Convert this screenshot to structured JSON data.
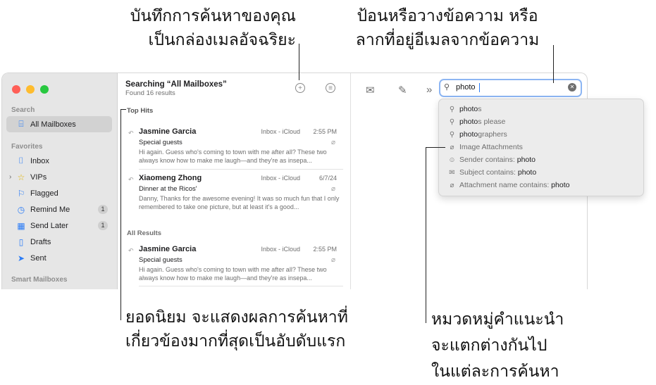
{
  "callouts": {
    "top_left": [
      "บันทึกการค้นหาของคุณ",
      "เป็นกล่องเมลอัจฉริยะ"
    ],
    "top_right": [
      "ป้อนหรือวางข้อความ หรือ",
      "ลากที่อยู่อีเมลจากข้อความ"
    ],
    "bottom_left": [
      "ยอดนิยม จะแสดงผลการค้นหาที่",
      "เกี่ยวข้องมากที่สุดเป็นอับดับแรก"
    ],
    "bottom_right": [
      "หมวดหมู่คำแนะนำ",
      "จะแตกต่างกันไป",
      "ในแต่ละการค้นหา"
    ]
  },
  "sidebar": {
    "search_section": "Search",
    "search_item": "All Mailboxes",
    "favorites_section": "Favorites",
    "items": [
      {
        "label": "Inbox",
        "icon": "inbox-icon",
        "badge": ""
      },
      {
        "label": "VIPs",
        "icon": "star-icon",
        "badge": ""
      },
      {
        "label": "Flagged",
        "icon": "flag-icon",
        "badge": ""
      },
      {
        "label": "Remind Me",
        "icon": "clock-icon",
        "badge": "1"
      },
      {
        "label": "Send Later",
        "icon": "calendar-icon",
        "badge": "1"
      },
      {
        "label": "Drafts",
        "icon": "document-icon",
        "badge": ""
      },
      {
        "label": "Sent",
        "icon": "paperplane-icon",
        "badge": ""
      }
    ],
    "smart_section": "Smart Mailboxes"
  },
  "list": {
    "title": "Searching “All Mailboxes”",
    "subtitle": "Found 16 results",
    "top_hits_header": "Top Hits",
    "all_results_header": "All Results",
    "messages": [
      {
        "from": "Jasmine Garcia",
        "mailbox": "Inbox - iCloud",
        "time": "2:55 PM",
        "subject": "Special guests",
        "preview": "Hi again. Guess who's coming to town with me after all? These two always know how to make me laugh—and they're as insepa..."
      },
      {
        "from": "Xiaomeng Zhong",
        "mailbox": "Inbox - iCloud",
        "time": "6/7/24",
        "subject": "Dinner at the Ricos'",
        "preview": "Danny, Thanks for the awesome evening! It was so much fun that I only remembered to take one picture, but at least it's a good..."
      },
      {
        "from": "Jasmine Garcia",
        "mailbox": "Inbox - iCloud",
        "time": "2:55 PM",
        "subject": "Special guests",
        "preview": "Hi again. Guess who's coming to town with me after all? These two always know how to make me laugh—and they're as insepa..."
      }
    ]
  },
  "search": {
    "value": "photo"
  },
  "suggestions": [
    {
      "icon": "search-icon",
      "match": "photo",
      "rest": "s"
    },
    {
      "icon": "search-icon",
      "match": "photo",
      "rest": "s please"
    },
    {
      "icon": "search-icon",
      "match": "photo",
      "rest": "graphers"
    },
    {
      "icon": "paperclip-icon",
      "label": "Image Attachments"
    },
    {
      "icon": "person-icon",
      "label": "Sender contains: ",
      "value": "photo"
    },
    {
      "icon": "envelope-icon",
      "label": "Subject contains: ",
      "value": "photo"
    },
    {
      "icon": "paperclip-icon",
      "label": "Attachment name contains: ",
      "value": "photo"
    }
  ],
  "colors": {
    "accent": "#2b7cf6",
    "close": "#ff5f57",
    "minimize": "#febc2e",
    "zoom": "#28c840"
  }
}
